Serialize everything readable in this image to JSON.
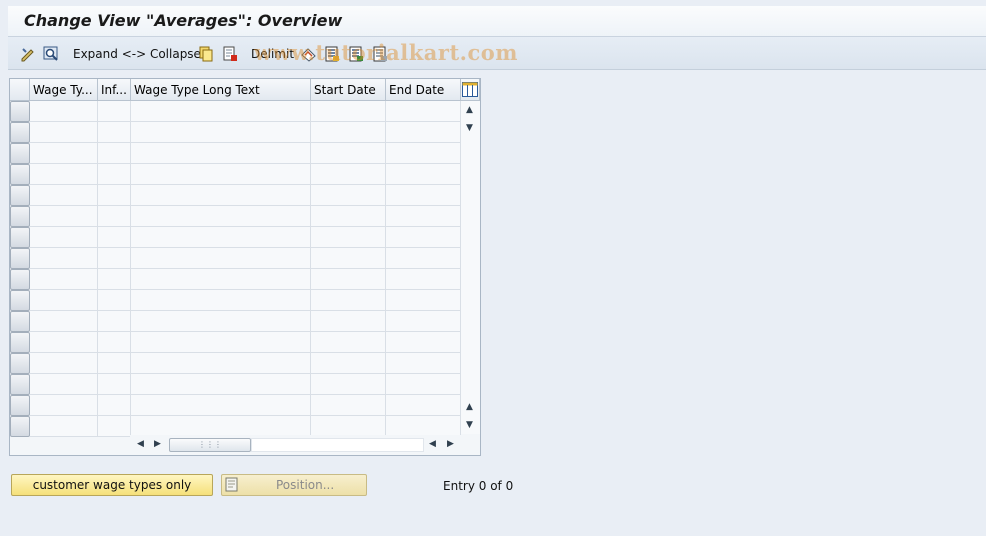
{
  "window": {
    "title": "Change View \"Averages\": Overview"
  },
  "toolbar": {
    "expand_collapse_label": "Expand <-> Collapse",
    "delimit_label": "Delimit",
    "watermark": "www.tutorialkart.com"
  },
  "table": {
    "columns": [
      "Wage Ty...",
      "Inf...",
      "Wage Type Long Text",
      "Start Date",
      "End Date"
    ],
    "rows": []
  },
  "buttons": {
    "customer_wage_types": "customer wage types only",
    "position": "Position..."
  },
  "status": {
    "entry_text": "Entry 0 of 0"
  },
  "colors": {
    "accent_yellow": "#f5e07a",
    "background": "#e9eef5"
  }
}
